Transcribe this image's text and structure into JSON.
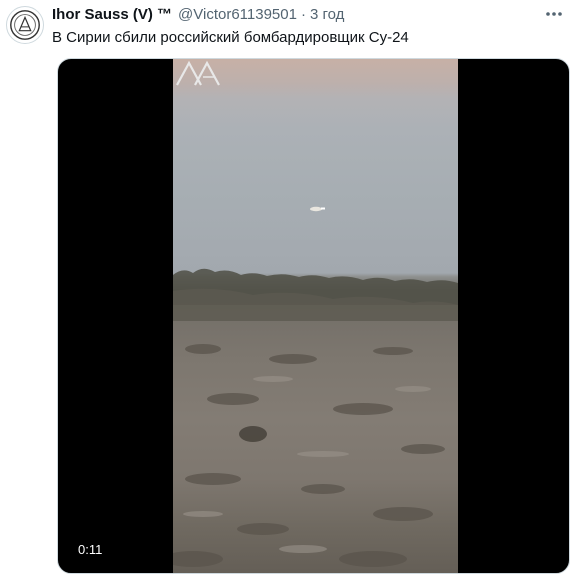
{
  "tweet": {
    "display_name": "Ihor Sauss (V) ™",
    "handle": "@Victor61139501",
    "separator": "·",
    "time": "3 год",
    "text": "В Сирии сбили российский бомбардировщик Су-24",
    "more_icon": "more-horizontal-icon"
  },
  "media": {
    "duration": "0:11",
    "watermark": "logo-mark",
    "letterbox_color": "#000000"
  },
  "colors": {
    "text_primary": "#0f1419",
    "text_secondary": "#536471",
    "border": "#cfd9de"
  }
}
